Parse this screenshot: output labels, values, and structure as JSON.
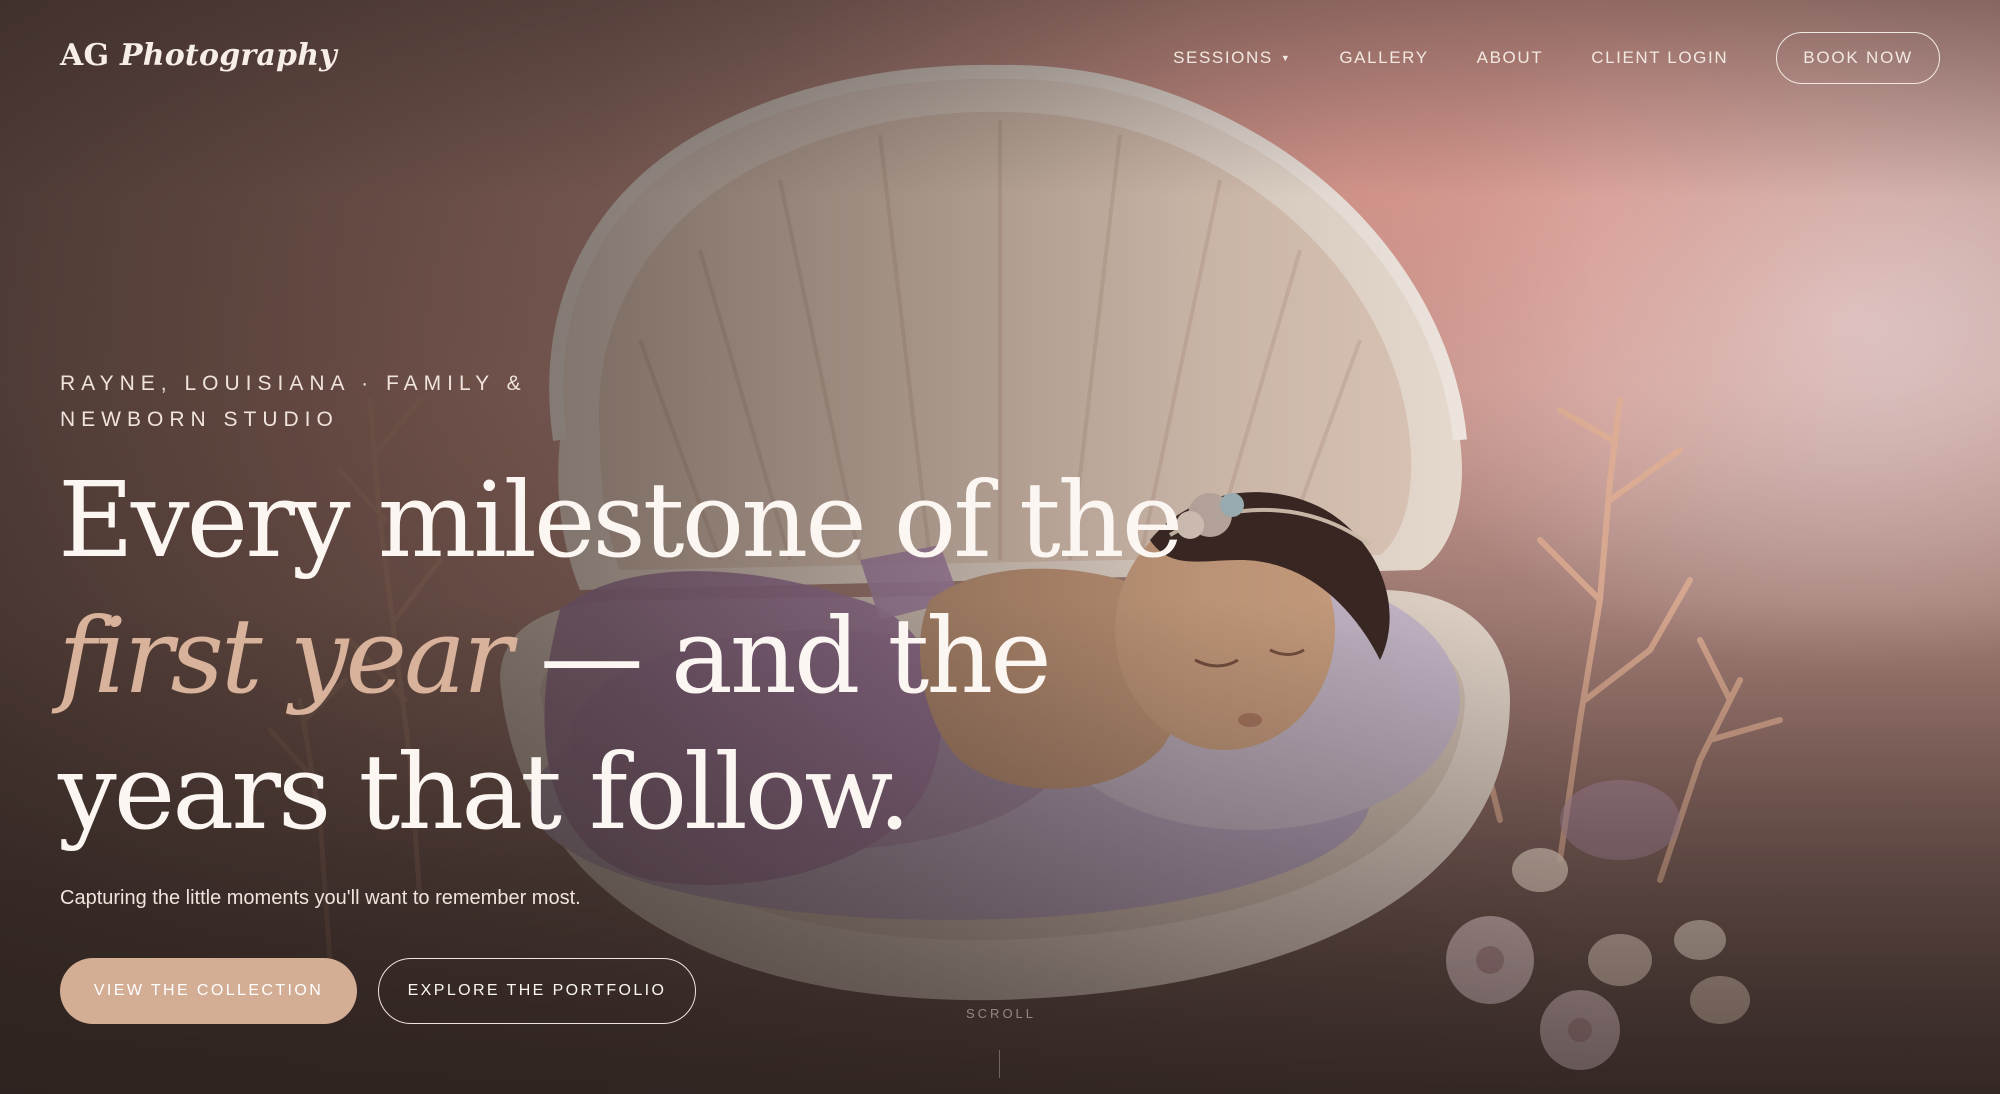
{
  "nav": {
    "logo_plain": "AG",
    "logo_italic": "Photography",
    "links": [
      {
        "label": "SESSIONS",
        "has_dropdown": true
      },
      {
        "label": "GALLERY"
      },
      {
        "label": "ABOUT"
      },
      {
        "label": "CLIENT LOGIN"
      }
    ],
    "cta": "BOOK NOW"
  },
  "hero": {
    "eyebrow": "RAYNE, LOUISIANA · FAMILY & NEWBORN STUDIO",
    "headline_line1": "Every milestone of the",
    "headline_accent": "first year",
    "headline_line2_rest": " — and the",
    "headline_line3": "years that follow.",
    "subline": "Capturing the little moments you'll want to remember most.",
    "primary_button": "VIEW THE COLLECTION",
    "secondary_button": "EXPLORE THE PORTFOLIO",
    "scroll_label": "SCROLL"
  },
  "colors": {
    "accent": "#d3ad94",
    "headline_accent": "#d8b29a",
    "text_light": "#fbf6f2"
  },
  "icons": {
    "dropdown": "caret-down-icon"
  }
}
